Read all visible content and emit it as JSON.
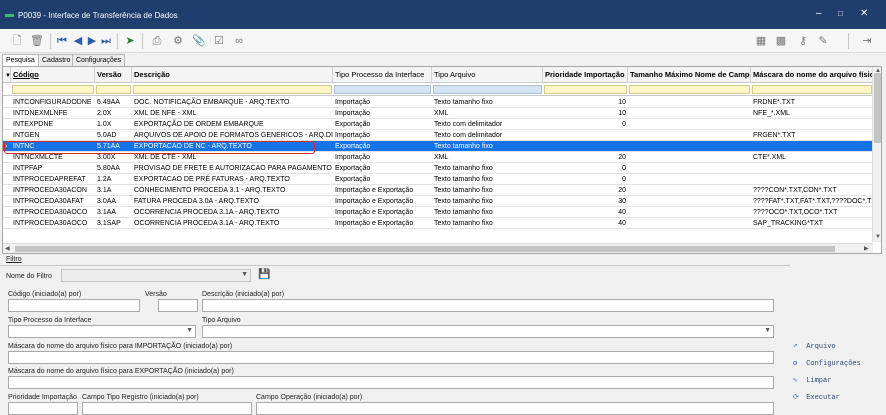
{
  "window": {
    "title": "P0039 - Interface de Transferência de Dados"
  },
  "toolbar": {
    "icons": [
      "new-icon",
      "delete-icon",
      "first-record-icon",
      "previous-record-icon",
      "next-record-icon",
      "last-record-icon",
      "execute-icon",
      "print-icon",
      "settings-icon",
      "attach-icon",
      "check-icon",
      "link-icon",
      "table-icon",
      "calculator-icon",
      "key-icon",
      "edit-icon",
      "exit-icon"
    ]
  },
  "tabs": [
    "Pesquisa",
    "Cadastro",
    "Configurações"
  ],
  "grid": {
    "columns": [
      "Código",
      "Versão",
      "Descrição",
      "Tipo Processo da Interface",
      "Tipo Arquivo",
      "Prioridade Importação",
      "Tamanho Máximo Nome de Campo",
      "Máscara do nome do arquivo físico"
    ],
    "selected_row": 4,
    "rows": [
      [
        "INTCONFIGURADODNE",
        "6.49AA",
        "DOC. NOTIFICAÇÃO EMBARQUE - ARQ.TEXTO",
        "Importação",
        "Texto tamanho fixo",
        "10",
        "",
        "FRDNE*.TXT"
      ],
      [
        "INTDNEXMLNFE",
        "2.0X",
        "XML DE NFE - XML",
        "Importação",
        "XML",
        "10",
        "",
        "NFE_*.XML"
      ],
      [
        "INTEXPDNE",
        "1.0X",
        "EXPORTAÇÃO DE ORDEM EMBARQUE",
        "Exportação",
        "Texto com delimitador",
        "0",
        "",
        ""
      ],
      [
        "INTGEN",
        "5.0AD",
        "ARQUIVOS DE APOIO DE FORMATOS GENERICOS - ARQ.DI",
        "Importação",
        "Texto com delimitador",
        "",
        "",
        "FRGEN*.TXT"
      ],
      [
        "INTNC",
        "5.71AA",
        "EXPORTACAO DE NC - ARQ.TEXTO",
        "Exportação",
        "Texto tamanho fixo",
        "",
        "",
        ""
      ],
      [
        "INTNCXMLCTE",
        "3.00X",
        "XML DE CTE - XML",
        "Importação",
        "XML",
        "20",
        "",
        "CTE*.XML"
      ],
      [
        "INTPFAP",
        "5.80AA",
        "PROVISAO DE FRETE E AUTORIZACAO PARA PAGAMENTO",
        "Exportação",
        "Texto tamanho fixo",
        "0",
        "",
        ""
      ],
      [
        "INTPROCEDAPREFAT",
        "1.2A",
        "EXPORTACAO DE PRÉ FATURAS - ARQ.TEXTO",
        "Exportação",
        "Texto tamanho fixo",
        "0",
        "",
        ""
      ],
      [
        "INTPROCEDA30ACON",
        "3.1A",
        "CONHECIMENTO PROCEDA 3.1 - ARQ.TEXTO",
        "Importação e Exportação",
        "Texto tamanho fixo",
        "20",
        "",
        "????CON*.TXT,CON*.TXT"
      ],
      [
        "INTPROCEDA30AFAT",
        "3.0AA",
        "FATURA PROCEDA 3.0A - ARQ.TEXTO",
        "Importação e Exportação",
        "Texto tamanho fixo",
        "30",
        "",
        "????FAT*.TXT,FAT*.TXT,????DOC*.TXT"
      ],
      [
        "INTPROCEDA30AOCO",
        "3.1AA",
        "OCORRENCIA PROCEDA 3.1A - ARQ.TEXTO",
        "Importação e Exportação",
        "Texto tamanho fixo",
        "40",
        "",
        "????OCO*.TXT,OCO*.TXT"
      ],
      [
        "INTPROCEDA30AOCO",
        "3.1SAP",
        "OCORRENCIA PROCEDA 3.1A - ARQ.TEXTO",
        "Importação e Exportação",
        "Texto tamanho fixo",
        "40",
        "",
        "SAP_TRACKING*TXT"
      ]
    ]
  },
  "filter": {
    "section_label": "Filtro",
    "nome_filtro_label": "Nome do Filtro",
    "codigo_label": "Código (iniciado(a) por)",
    "versao_label": "Versão",
    "descricao_label": "Descrição (iniciado(a) por)",
    "tipo_processo_label": "Tipo Processo da Interface",
    "tipo_arquivo_label": "Tipo Arquivo",
    "mascara_import_label": "Máscara do nome do arquivo físico para IMPORTAÇÃO (iniciado(a) por)",
    "mascara_export_label": "Máscara do nome do arquivo físico para EXPORTAÇÃO (iniciado(a) por)",
    "prioridade_label": "Prioridade Importação",
    "campo_tipo_label": "Campo Tipo Registro (iniciado(a) por)",
    "campo_operacao_label": "Campo Operação (iniciado(a) por)"
  },
  "actions": {
    "arquivo": "Arquivo",
    "configuracoes": "Configurações",
    "limpar": "Limpar",
    "executar": "Executar"
  }
}
